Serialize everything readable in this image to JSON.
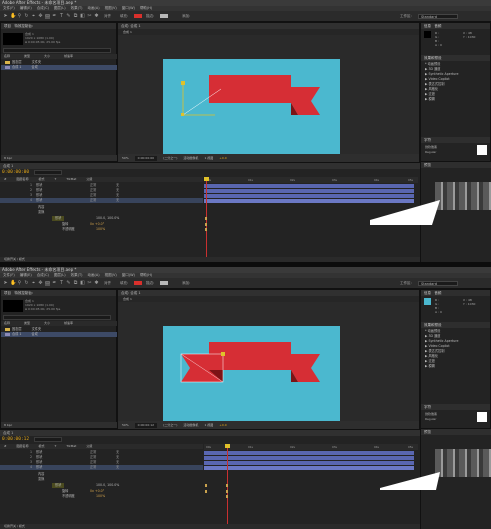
{
  "app": {
    "title": "Adobe After Effects - 未命名项目.aep *",
    "menus": [
      "文件(F)",
      "编辑(E)",
      "合成(C)",
      "图层(L)",
      "效果(T)",
      "动画(A)",
      "视图(V)",
      "窗口(W)",
      "帮助(H)"
    ],
    "workspace_label": "工作区:",
    "workspace_value": "Standard",
    "toolbar_snap": "对齐",
    "toolbar_fill_label": "填充:",
    "toolbar_stroke_label": "描边:",
    "toolbar_add_label": "添加:",
    "colors": {
      "fill": "#d9302c",
      "stroke": "#b8b8b8",
      "canvas": "#4bb8cf",
      "ribbon": "#d62e35",
      "ribbon_dark": "#7c1316",
      "timecode": "#e6a817",
      "track": "#5966b0",
      "cti": "#e0c12a"
    }
  },
  "project": {
    "tab": "项目",
    "tab2": "特效控制台:",
    "comp_name": "合成 1",
    "comp_info_1": "1920 x 1080 (1.00)",
    "comp_info_2": "Δ 0:00:05:00, 25.00 fps",
    "columns": [
      "名称",
      "类型",
      "大小",
      "帧速率"
    ],
    "items": [
      {
        "name": "固态层",
        "type": "文件夹"
      },
      {
        "name": "合成 1",
        "type": "合成"
      }
    ],
    "footer": "8 bpc"
  },
  "composition": {
    "tabs": "合成: 合成 1",
    "breadcrumb": "合成 1",
    "zoom": "50%",
    "time": "0:00:00:00",
    "resolution": "(二分之一)",
    "camera": "活动摄像机",
    "views": "1 视图",
    "exposure": "+0.0"
  },
  "info_panel": {
    "tab": "信息",
    "tab2": "音频",
    "rgb": [
      "R :",
      "G :",
      "B :",
      "A : 0"
    ],
    "xy": [
      "X : 48",
      "Y : 1030"
    ],
    "swatch_top": "#000000",
    "swatch_bottom": "#4bb8cf"
  },
  "effects_panel": {
    "tab": "效果和预设",
    "items": [
      "* 动画预设",
      "▶ 3D 通道",
      "▶ Synthetic Aperture",
      "▶ Video Copilot",
      "▶ 表达式控制",
      "▶ 风格化",
      "▶ 过渡",
      "▶ 模糊"
    ]
  },
  "char_panel": {
    "tab": "字符",
    "font": "微软雅黑",
    "style": "Regular"
  },
  "timeline": {
    "tab": "合成 1",
    "timecode_1": "0:00:00:00",
    "timecode_2": "0:00:00:12",
    "columns": [
      "#",
      "图层名称",
      "模式",
      "T",
      "TrkMat",
      "父级"
    ],
    "layers": [
      {
        "num": "1",
        "name": "形状",
        "mode": "正常",
        "parent": "无"
      },
      {
        "num": "2",
        "name": "形状",
        "mode": "正常",
        "parent": "无"
      },
      {
        "num": "3",
        "name": "形状",
        "mode": "正常",
        "parent": "无"
      },
      {
        "num": "4",
        "name": "形状",
        "mode": "正常",
        "parent": "无"
      }
    ],
    "group_label": "内容",
    "transform_label": "变换",
    "prop_anchor": "锚点",
    "prop_position": "位置",
    "prop_scale": "缩放",
    "prop_rotation": "旋转",
    "rotation_val": "0x +0.0°",
    "scale_val": "100.0, 100.0%",
    "opacity_label": "不透明度",
    "opacity_val": "100%",
    "parent_add": "添加:",
    "ticks": [
      "00s",
      "01s",
      "02s",
      "03s",
      "04s",
      "05s"
    ],
    "footer": "切换开关 / 模式"
  },
  "preview_panel": {
    "tab": "预览"
  }
}
